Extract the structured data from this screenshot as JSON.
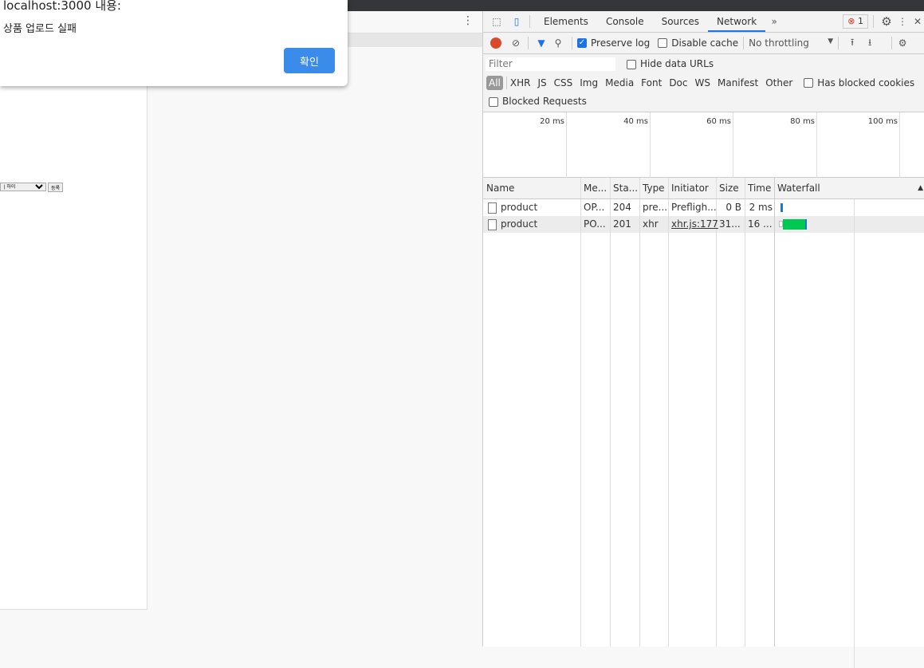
{
  "dialog": {
    "title": "localhost:3000 내용:",
    "message": "상품 업로드 실패",
    "ok_label": "확인"
  },
  "page": {
    "select_value": "| 하이",
    "submit_label": "등록"
  },
  "devtools": {
    "tabs": [
      "Elements",
      "Console",
      "Sources",
      "Network"
    ],
    "active_tab": "Network",
    "more_tabs": "»",
    "error_count": "1",
    "toolbar": {
      "preserve_log": "Preserve log",
      "preserve_log_checked": true,
      "disable_cache": "Disable cache",
      "throttling": "No throttling"
    },
    "filter": {
      "placeholder": "Filter",
      "hide_data_urls": "Hide data URLs",
      "types": [
        "All",
        "XHR",
        "JS",
        "CSS",
        "Img",
        "Media",
        "Font",
        "Doc",
        "WS",
        "Manifest",
        "Other"
      ],
      "has_blocked_cookies": "Has blocked cookies",
      "blocked_requests": "Blocked Requests"
    },
    "timeline_ticks": [
      "20 ms",
      "40 ms",
      "60 ms",
      "80 ms",
      "100 ms"
    ],
    "columns": [
      "Name",
      "Me...",
      "Sta...",
      "Type",
      "Initiator",
      "Size",
      "Time",
      "Waterfall"
    ],
    "rows": [
      {
        "name": "product",
        "method": "OP...",
        "status": "204",
        "type": "pre...",
        "initiator": "Prefligh...",
        "size": "0 B",
        "time": "2 ms"
      },
      {
        "name": "product",
        "method": "PO...",
        "status": "201",
        "type": "xhr",
        "initiator": "xhr.js:177",
        "size": "31...",
        "time": "16 ..."
      }
    ],
    "colors": {
      "accent": "#1a73e8",
      "waterfall_green": "#00c853",
      "record_red": "#d94a2b"
    }
  }
}
